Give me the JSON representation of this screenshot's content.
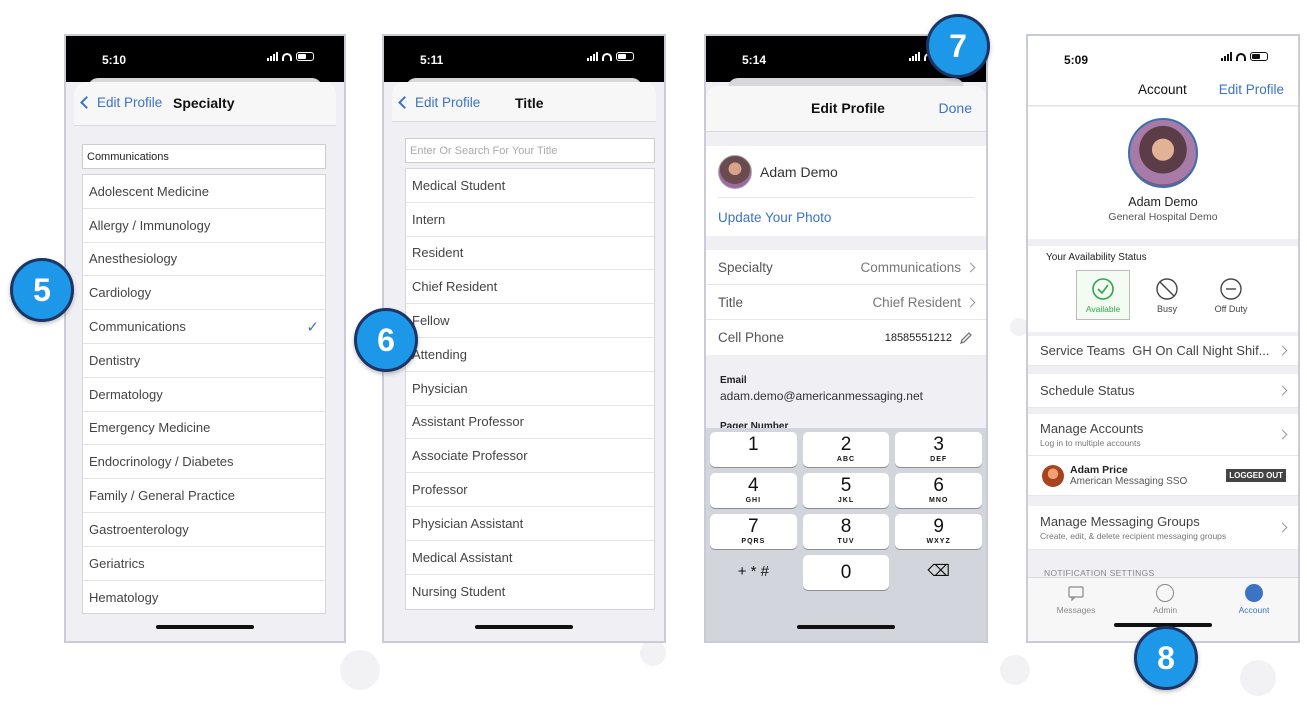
{
  "colors": {
    "accent": "#3b73c5",
    "badge": "#1d97e8",
    "available": "#2fa64b"
  },
  "badges": [
    "5",
    "6",
    "7",
    "8"
  ],
  "phone1": {
    "time": "5:10",
    "back_label": "Edit Profile",
    "title": "Specialty",
    "search_value": "Communications",
    "items": [
      "Adolescent Medicine",
      "Allergy / Immunology",
      "Anesthesiology",
      "Cardiology",
      "Communications",
      "Dentistry",
      "Dermatology",
      "Emergency Medicine",
      "Endocrinology / Diabetes",
      "Family / General Practice",
      "Gastroenterology",
      "Geriatrics",
      "Hematology"
    ],
    "check": "✓"
  },
  "phone2": {
    "time": "5:11",
    "back_label": "Edit Profile",
    "title": "Title",
    "search_placeholder": "Enter Or Search For Your Title",
    "items": [
      "Medical Student",
      "Intern",
      "Resident",
      "Chief Resident",
      "Fellow",
      "Attending",
      "Physician",
      "Assistant Professor",
      "Associate Professor",
      "Professor",
      "Physician Assistant",
      "Medical Assistant",
      "Nursing Student"
    ]
  },
  "phone3": {
    "time": "5:14",
    "title": "Edit Profile",
    "done_label": "Done",
    "name": "Adam Demo",
    "update_photo": "Update Your Photo",
    "specialty_label": "Specialty",
    "specialty_value": "Communications",
    "title_label": "Title",
    "title_value": "Chief Resident",
    "cell_label": "Cell Phone",
    "cell_value": "18585551212",
    "email_label": "Email",
    "email_value": "adam.demo@americanmessaging.net",
    "pager_label": "Pager Number",
    "keys": [
      {
        "n": "1",
        "l": ""
      },
      {
        "n": "2",
        "l": "ABC"
      },
      {
        "n": "3",
        "l": "DEF"
      },
      {
        "n": "4",
        "l": "GHI"
      },
      {
        "n": "5",
        "l": "JKL"
      },
      {
        "n": "6",
        "l": "MNO"
      },
      {
        "n": "7",
        "l": "PQRS"
      },
      {
        "n": "8",
        "l": "TUV"
      },
      {
        "n": "9",
        "l": "WXYZ"
      }
    ],
    "key_symbols": "+ * #",
    "key_zero": "0",
    "key_delete": "⌫"
  },
  "phone4": {
    "time": "5:09",
    "title": "Account",
    "edit_label": "Edit Profile",
    "name": "Adam Demo",
    "org": "General Hospital Demo",
    "availability_heading": "Your Availability Status",
    "statuses": [
      "Available",
      "Busy",
      "Off Duty"
    ],
    "service_teams_label": "Service Teams",
    "service_teams_value": "GH On Call Night Shif...",
    "schedule_status": "Schedule Status",
    "manage_accounts": "Manage Accounts",
    "manage_accounts_sub": "Log in to multiple accounts",
    "other_account_name": "Adam Price",
    "other_account_org": "American Messaging SSO",
    "logged_out": "LOGGED OUT",
    "manage_groups": "Manage Messaging Groups",
    "manage_groups_sub": "Create, edit, & delete recipient messaging groups",
    "notification_settings": "NOTIFICATION SETTINGS",
    "tabs": [
      "Messages",
      "Admin",
      "Account"
    ]
  }
}
